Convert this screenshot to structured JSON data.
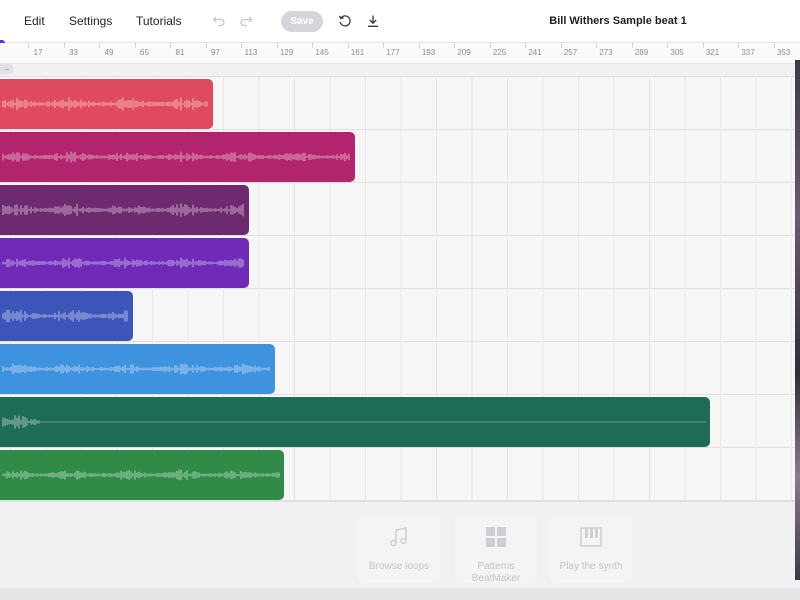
{
  "menu": {
    "edit": "Edit",
    "settings": "Settings",
    "tutorials": "Tutorials"
  },
  "toolbar": {
    "undo_icon": "undo-icon",
    "redo_icon": "redo-icon",
    "save_label": "Save",
    "history_icon": "history-icon",
    "download_icon": "download-icon"
  },
  "project": {
    "title": "Bill Withers Sample beat 1"
  },
  "ruler": {
    "ticks": [
      "17",
      "33",
      "49",
      "65",
      "81",
      "97",
      "113",
      "129",
      "145",
      "161",
      "177",
      "193",
      "209",
      "225",
      "241",
      "257",
      "273",
      "289",
      "305",
      "321",
      "337",
      "353"
    ]
  },
  "tracks": [
    {
      "name": "track-1",
      "color": "#e04a5e",
      "length_bars": 24
    },
    {
      "name": "track-2",
      "color": "#b3246e",
      "length_bars": 40
    },
    {
      "name": "track-3",
      "color": "#6e2a6e",
      "length_bars": 28
    },
    {
      "name": "track-4",
      "color": "#6f2ab8",
      "length_bars": 28
    },
    {
      "name": "track-5",
      "color": "#3d55b8",
      "length_bars": 15
    },
    {
      "name": "track-6",
      "color": "#3f92de",
      "length_bars": 31
    },
    {
      "name": "track-7",
      "color": "#1e6b56",
      "length_bars": 80
    },
    {
      "name": "track-8",
      "color": "#2f8b47",
      "length_bars": 32
    }
  ],
  "bottom_cards": [
    {
      "label": "Browse loops",
      "icon": "music-note-icon"
    },
    {
      "label": "Patterns BeatMaker",
      "icon": "grid-pads-icon"
    },
    {
      "label": "Play the synth",
      "icon": "piano-keys-icon"
    }
  ]
}
